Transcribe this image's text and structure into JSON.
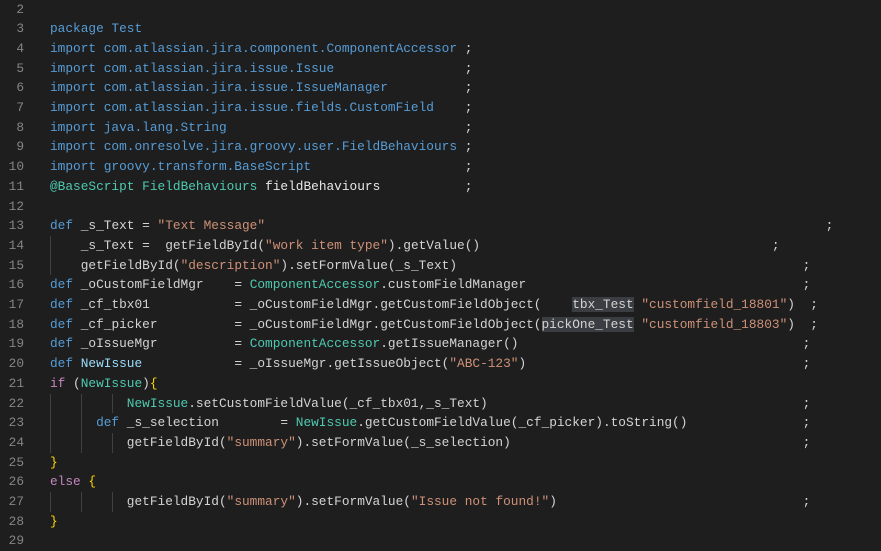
{
  "editor": {
    "colors": {
      "background": "#1e1e1e",
      "keyword": "#569cd6",
      "type": "#4ec9b0",
      "string": "#ce9178",
      "text": "#d4d4d4",
      "control": "#c586c0",
      "brace": "#ffd700",
      "line_number": "#858585"
    },
    "lines": [
      {
        "n": "2",
        "tokens": []
      },
      {
        "n": "3",
        "tokens": [
          {
            "t": "package Test",
            "c": "k"
          }
        ]
      },
      {
        "n": "4",
        "tokens": [
          {
            "t": "import com.atlassian.jira.component.ComponentAccessor",
            "c": "k"
          },
          {
            "t": " ;",
            "c": "d"
          }
        ]
      },
      {
        "n": "5",
        "tokens": [
          {
            "t": "import com.atlassian.jira.issue.Issue",
            "c": "k"
          },
          {
            "t": "                 ;",
            "c": "d"
          }
        ]
      },
      {
        "n": "6",
        "tokens": [
          {
            "t": "import com.atlassian.jira.issue.IssueManager",
            "c": "k"
          },
          {
            "t": "          ;",
            "c": "d"
          }
        ]
      },
      {
        "n": "7",
        "tokens": [
          {
            "t": "import com.atlassian.jira.issue.fields.CustomField",
            "c": "k"
          },
          {
            "t": "    ;",
            "c": "d"
          }
        ]
      },
      {
        "n": "8",
        "tokens": [
          {
            "t": "import java.lang.String",
            "c": "k"
          },
          {
            "t": "                               ;",
            "c": "d"
          }
        ]
      },
      {
        "n": "9",
        "tokens": [
          {
            "t": "import com.onresolve.jira.groovy.user.FieldBehaviours",
            "c": "k"
          },
          {
            "t": " ;",
            "c": "d"
          }
        ]
      },
      {
        "n": "10",
        "tokens": [
          {
            "t": "import groovy.transform.BaseScript",
            "c": "k"
          },
          {
            "t": "                    ;",
            "c": "d"
          }
        ]
      },
      {
        "n": "11",
        "tokens": [
          {
            "t": "@BaseScript",
            "c": "t"
          },
          {
            "t": " ",
            "c": "d"
          },
          {
            "t": "FieldBehaviours",
            "c": "t"
          },
          {
            "t": " ",
            "c": "d"
          },
          {
            "t": "fieldBehaviours",
            "c": "w"
          },
          {
            "t": "           ;",
            "c": "d"
          }
        ]
      },
      {
        "n": "12",
        "tokens": []
      },
      {
        "n": "13",
        "tokens": [
          {
            "t": "def",
            "c": "k"
          },
          {
            "t": " _s_Text = ",
            "c": "d"
          },
          {
            "t": "\"Text Message\"",
            "c": "s"
          },
          {
            "t": "                                                                         ;",
            "c": "d"
          }
        ]
      },
      {
        "n": "14",
        "tokens": [
          {
            "t": "    _s_Text =  getFieldById(",
            "c": "d"
          },
          {
            "t": "\"work item type\"",
            "c": "s"
          },
          {
            "t": ").getValue()",
            "c": "d"
          },
          {
            "t": "                                      ;",
            "c": "d"
          }
        ]
      },
      {
        "n": "15",
        "tokens": [
          {
            "t": "    getFieldById(",
            "c": "d"
          },
          {
            "t": "\"description\"",
            "c": "s"
          },
          {
            "t": ").setFormValue(_s_Text)",
            "c": "d"
          },
          {
            "t": "                                             ;",
            "c": "d"
          }
        ]
      },
      {
        "n": "16",
        "tokens": [
          {
            "t": "def",
            "c": "k"
          },
          {
            "t": " _oCustomFieldMgr    = ",
            "c": "d"
          },
          {
            "t": "ComponentAccessor",
            "c": "t"
          },
          {
            "t": ".customFieldManager",
            "c": "d"
          },
          {
            "t": "                                    ;",
            "c": "d"
          }
        ]
      },
      {
        "n": "17",
        "tokens": [
          {
            "t": "def",
            "c": "k"
          },
          {
            "t": " _cf_tbx01           = _oCustomFieldMgr.getCustomFieldObject(    ",
            "c": "d"
          },
          {
            "t": "tbx_Test",
            "c": "h"
          },
          {
            "t": " ",
            "c": "d"
          },
          {
            "t": "\"customfield_18801\"",
            "c": "s"
          },
          {
            "t": ")  ;",
            "c": "d"
          }
        ]
      },
      {
        "n": "18",
        "tokens": [
          {
            "t": "def",
            "c": "k"
          },
          {
            "t": " _cf_picker          = _oCustomFieldMgr.getCustomFieldObject(",
            "c": "d"
          },
          {
            "t": "pickOne_Test",
            "c": "h"
          },
          {
            "t": " ",
            "c": "d"
          },
          {
            "t": "\"customfield_18803\"",
            "c": "s"
          },
          {
            "t": ")  ;",
            "c": "d"
          }
        ]
      },
      {
        "n": "19",
        "tokens": [
          {
            "t": "def",
            "c": "k"
          },
          {
            "t": " _oIssueMgr          = ",
            "c": "d"
          },
          {
            "t": "ComponentAccessor",
            "c": "t"
          },
          {
            "t": ".getIssueManager()",
            "c": "d"
          },
          {
            "t": "                                     ;",
            "c": "d"
          }
        ]
      },
      {
        "n": "20",
        "tokens": [
          {
            "t": "def",
            "c": "k"
          },
          {
            "t": " ",
            "c": "d"
          },
          {
            "t": "NewIssue",
            "c": "v"
          },
          {
            "t": "            = _oIssueMgr.getIssueObject(",
            "c": "d"
          },
          {
            "t": "\"ABC-123\"",
            "c": "s"
          },
          {
            "t": ")",
            "c": "d"
          },
          {
            "t": "                                    ;",
            "c": "d"
          }
        ]
      },
      {
        "n": "21",
        "tokens": [
          {
            "t": "if",
            "c": "c"
          },
          {
            "t": " (",
            "c": "d"
          },
          {
            "t": "NewIssue",
            "c": "t"
          },
          {
            "t": ")",
            "c": "d"
          },
          {
            "t": "{",
            "c": "b"
          }
        ]
      },
      {
        "n": "22",
        "tokens": [
          {
            "t": "          ",
            "c": "d"
          },
          {
            "t": "NewIssue",
            "c": "t"
          },
          {
            "t": ".setCustomFieldValue(_cf_tbx01,_s_Text)",
            "c": "d"
          },
          {
            "t": "                                         ;",
            "c": "d"
          }
        ]
      },
      {
        "n": "23",
        "tokens": [
          {
            "t": "      ",
            "c": "d"
          },
          {
            "t": "def",
            "c": "k"
          },
          {
            "t": " _s_selection        = ",
            "c": "d"
          },
          {
            "t": "NewIssue",
            "c": "t"
          },
          {
            "t": ".getCustomFieldValue(_cf_picker).toString()",
            "c": "d"
          },
          {
            "t": "               ;",
            "c": "d"
          }
        ]
      },
      {
        "n": "24",
        "tokens": [
          {
            "t": "          getFieldById(",
            "c": "d"
          },
          {
            "t": "\"summary\"",
            "c": "s"
          },
          {
            "t": ").setFormValue(_s_selection)",
            "c": "d"
          },
          {
            "t": "                                      ;",
            "c": "d"
          }
        ]
      },
      {
        "n": "25",
        "tokens": [
          {
            "t": "}",
            "c": "b"
          }
        ]
      },
      {
        "n": "26",
        "tokens": [
          {
            "t": "else",
            "c": "c"
          },
          {
            "t": " ",
            "c": "d"
          },
          {
            "t": "{",
            "c": "b"
          }
        ]
      },
      {
        "n": "27",
        "tokens": [
          {
            "t": "          getFieldById(",
            "c": "d"
          },
          {
            "t": "\"summary\"",
            "c": "s"
          },
          {
            "t": ").setFormValue(",
            "c": "d"
          },
          {
            "t": "\"Issue not found!\"",
            "c": "s"
          },
          {
            "t": ")",
            "c": "d"
          },
          {
            "t": "                                ;",
            "c": "d"
          }
        ]
      },
      {
        "n": "28",
        "tokens": [
          {
            "t": "}",
            "c": "b"
          }
        ]
      },
      {
        "n": "29",
        "tokens": []
      }
    ]
  }
}
